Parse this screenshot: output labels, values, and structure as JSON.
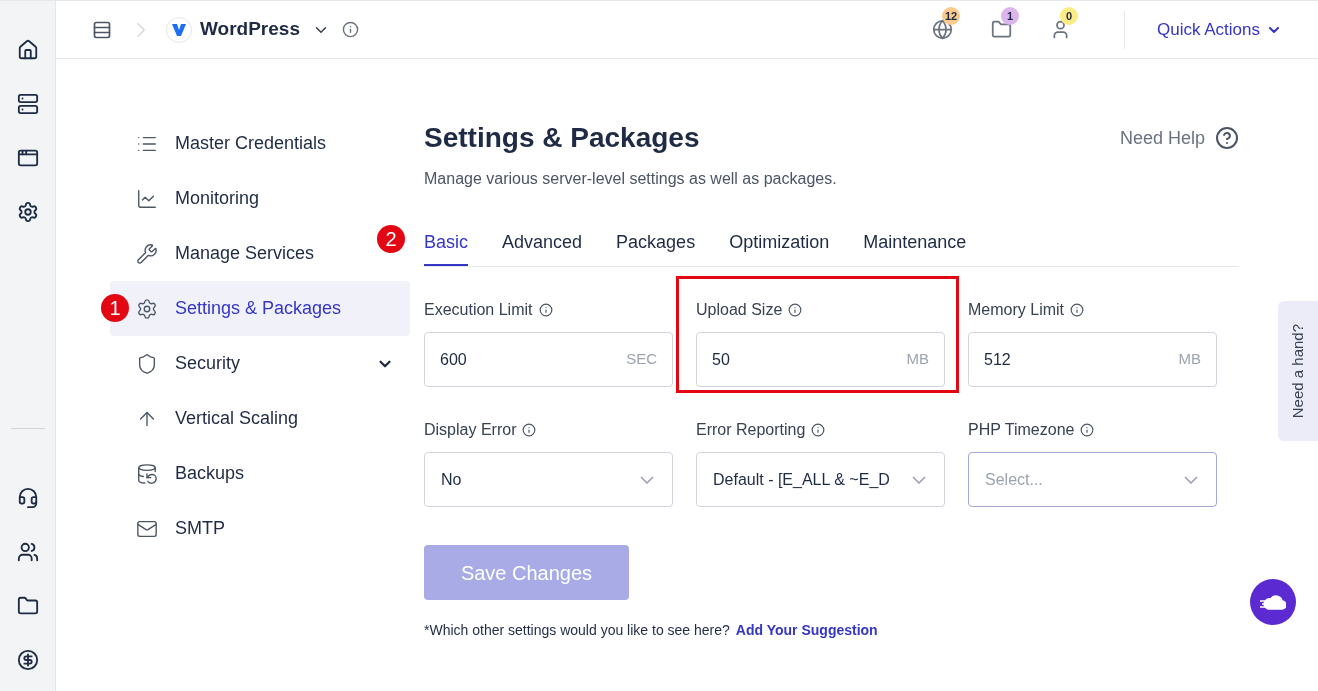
{
  "topbar": {
    "app_name": "WordPress",
    "badges": [
      {
        "kind": "www",
        "count": "12",
        "color": "#fcc98e"
      },
      {
        "kind": "folder",
        "count": "1",
        "color": "#dcb5ee"
      },
      {
        "kind": "user",
        "count": "0",
        "color": "#fdeb85"
      }
    ],
    "quick_actions": "Quick Actions"
  },
  "nav": [
    {
      "label": "Master Credentials",
      "selected": false
    },
    {
      "label": "Monitoring",
      "selected": false
    },
    {
      "label": "Manage Services",
      "selected": false
    },
    {
      "label": "Settings & Packages",
      "selected": true,
      "annotation": "1"
    },
    {
      "label": "Security",
      "selected": false,
      "expanded": false
    },
    {
      "label": "Vertical Scaling",
      "selected": false
    },
    {
      "label": "Backups",
      "selected": false
    },
    {
      "label": "SMTP",
      "selected": false
    }
  ],
  "page": {
    "title": "Settings & Packages",
    "subtitle": "Manage various server-level settings as well as packages.",
    "help": "Need Help"
  },
  "tabs": [
    {
      "label": "Basic",
      "selected": true,
      "annotation": "2"
    },
    {
      "label": "Advanced",
      "selected": false
    },
    {
      "label": "Packages",
      "selected": false
    },
    {
      "label": "Optimization",
      "selected": false
    },
    {
      "label": "Maintenance",
      "selected": false
    }
  ],
  "fields": [
    {
      "kind": "input",
      "label": "Execution Limit",
      "value": "600",
      "unit": "SEC",
      "highlighted": false
    },
    {
      "kind": "input",
      "label": "Upload Size",
      "value": "50",
      "unit": "MB",
      "highlighted": true
    },
    {
      "kind": "input",
      "label": "Memory Limit",
      "value": "512",
      "unit": "MB",
      "highlighted": false
    },
    {
      "kind": "select",
      "label": "Display Error",
      "value": "No",
      "highlighted": false
    },
    {
      "kind": "select",
      "label": "Error Reporting",
      "value": "Default - [E_ALL & ~E_D",
      "highlighted": false
    },
    {
      "kind": "select",
      "label": "PHP Timezone",
      "placeholder": "Select...",
      "highlighted": false
    }
  ],
  "save_button": {
    "label": "Save Changes",
    "disabled": true
  },
  "footnote": {
    "text": "*Which other settings would you like to see here?",
    "link": "Add Your Suggestion"
  },
  "side_tab": "Need a hand?"
}
